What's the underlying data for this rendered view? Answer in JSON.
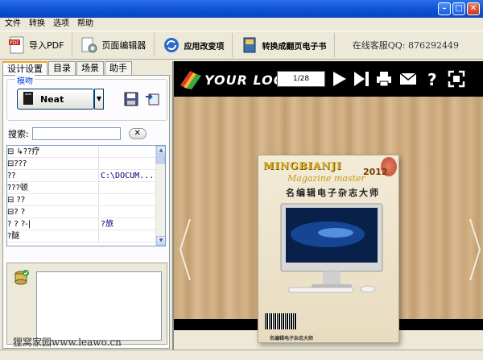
{
  "menu": [
    "文件",
    "转换",
    "选项",
    "帮助"
  ],
  "toolbar": {
    "import_pdf": "导入PDF",
    "page_editor": "页面编辑器",
    "apply_changes": "应用改变项",
    "convert_book": "转换成翻页电子书",
    "support_qq": "在线客服QQ: 876292449"
  },
  "tabs": [
    "设计设置",
    "目录",
    "场景",
    "助手"
  ],
  "theme": {
    "legend": "模吻",
    "name": "Neat"
  },
  "search": {
    "label": "搜索:",
    "value": ""
  },
  "tree": [
    {
      "name": "⊟  ↳??疗",
      "value": ""
    },
    {
      "name": " ⊟???",
      "value": ""
    },
    {
      "name": "        ??",
      "value": "C:\\DOCUM..."
    },
    {
      "name": "        ???顿",
      "value": ""
    },
    {
      "name": " ⊟  ??",
      "value": ""
    },
    {
      "name": "    ⊟?    ?",
      "value": ""
    },
    {
      "name": "        ?    ?  ?-|",
      "value": "?旅"
    },
    {
      "name": "        ?醚",
      "value": ""
    }
  ],
  "watermark": "狸窝家园www.leawo.cn",
  "preview": {
    "logo": "YOUR LOGO",
    "page_counter": "1/28",
    "cover": {
      "brand": "MINGBIANJI",
      "year": "2012",
      "subtitle": "Magazine master",
      "title": "名编辑电子杂志大师",
      "footer": "名编辑电子杂志大师"
    }
  }
}
